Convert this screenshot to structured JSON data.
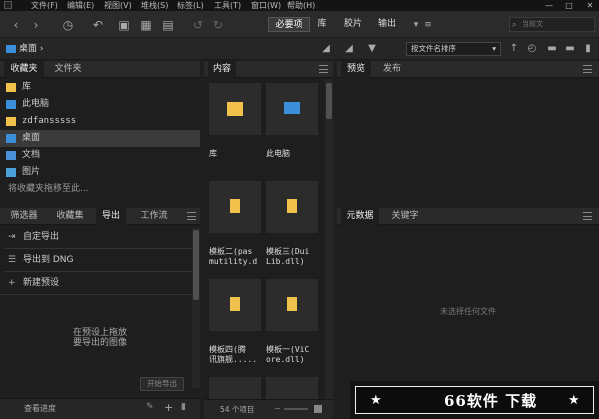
{
  "menu": [
    "文件(F)",
    "编辑(E)",
    "视图(V)",
    "堆栈(S)",
    "标签(L)",
    "工具(T)",
    "窗口(W)",
    "帮助(H)"
  ],
  "workspaces": [
    "必要项",
    "库",
    "胶片",
    "输出"
  ],
  "search": {
    "placeholder": "当前文"
  },
  "path": {
    "crumb": "桌面"
  },
  "sort": {
    "value": "按文件名排序"
  },
  "left_tabs": {
    "favorites": "收藏夹",
    "folders": "文件夹"
  },
  "favorites": [
    {
      "label": "库",
      "icon": "library-icon"
    },
    {
      "label": "此电脑",
      "icon": "computer-icon"
    },
    {
      "label": "zdfansssss",
      "icon": "folder-icon"
    },
    {
      "label": "桌面",
      "icon": "desktop-icon",
      "selected": true
    },
    {
      "label": "文档",
      "icon": "documents-icon"
    },
    {
      "label": "图片",
      "icon": "pictures-icon"
    }
  ],
  "favorites_hint": "将收藏夹拖移至此...",
  "lower_tabs": [
    "筛选器",
    "收藏集",
    "导出",
    "工作流"
  ],
  "export": {
    "items": [
      "自定导出",
      "导出到 DNG",
      "新建预设"
    ],
    "drop_hint_1": "在预设上拖放",
    "drop_hint_2": "要导出的图像",
    "start_button": "开始导出",
    "progress_label": "查看进度"
  },
  "content": {
    "tab": "内容",
    "items": [
      {
        "label": "库",
        "type": "library"
      },
      {
        "label": "此电脑",
        "type": "computer"
      },
      {
        "label": "模板二(pas\nmutility.d",
        "type": "folder"
      },
      {
        "label": "模板三(Dui\nLib.dll)",
        "type": "folder"
      },
      {
        "label": "模板四(腾\n讯旗舰.....",
        "type": "folder"
      },
      {
        "label": "模板一(ViC\nore.dll)",
        "type": "folder"
      }
    ],
    "count": "54 个项目"
  },
  "preview": {
    "tab1": "预览",
    "tab2": "发布"
  },
  "metadata": {
    "tab1": "元数据",
    "tab2": "关键字",
    "empty": "未选择任何文件"
  },
  "banner": {
    "text": "66软件 下载"
  },
  "colors": {
    "accent": "#3b8fd8",
    "folder": "#f0c24b",
    "bg": "#1e1e1e"
  }
}
